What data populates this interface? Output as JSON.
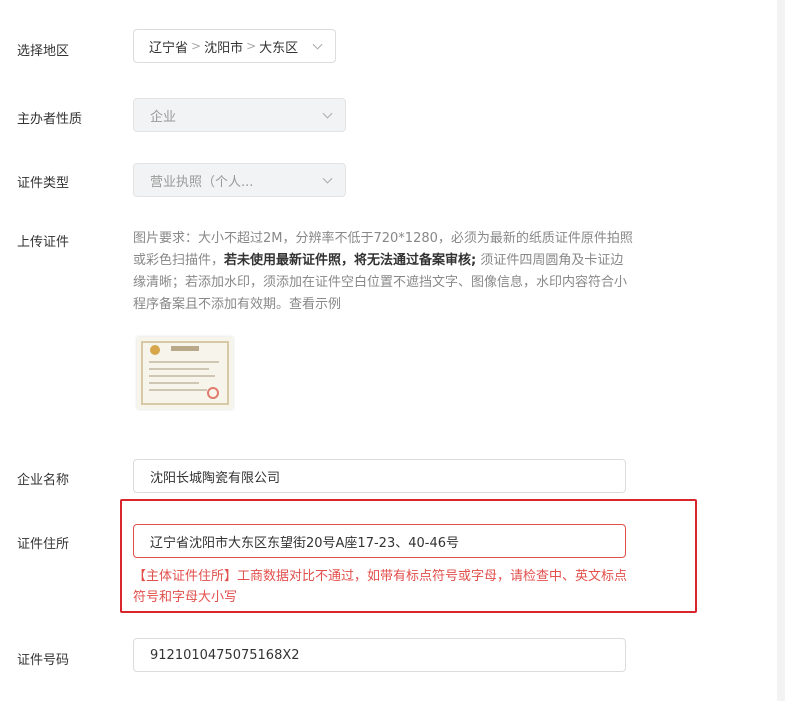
{
  "region": {
    "label": "选择地区",
    "province": "辽宁省",
    "city": "沈阳市",
    "district": "大东区",
    "sep": ">"
  },
  "organizer_nature": {
    "label": "主办者性质",
    "value": "企业"
  },
  "cert_type": {
    "label": "证件类型",
    "value": "营业执照（个人..."
  },
  "upload": {
    "label": "上传证件",
    "hint_part1": "图片要求：大小不超过2M，分辨率不低于720*1280，必须为最新的纸质证件原件拍照或彩色扫描件，",
    "hint_bold": "若未使用最新证件照，将无法通过备案审核;",
    "hint_part2": " 须证件四周圆角及卡证边缘清晰；若添加水印，须添加在证件空白位置不遮挡文字、图像信息，水印内容符合小程序备案且不添加有效期。",
    "example_link": "查看示例"
  },
  "company_name": {
    "label": "企业名称",
    "value": "沈阳长城陶瓷有限公司"
  },
  "cert_address": {
    "label": "证件住所",
    "value": "辽宁省沈阳市大东区东望街20号A座17-23、40-46号",
    "error": "【主体证件住所】工商数据对比不通过，如带有标点符号或字母，请检查中、英文标点符号和字母大小写"
  },
  "cert_number": {
    "label": "证件号码",
    "value": "9121010475075168X2"
  },
  "colors": {
    "error": "#e2504c",
    "highlight_border": "#d9262c"
  }
}
